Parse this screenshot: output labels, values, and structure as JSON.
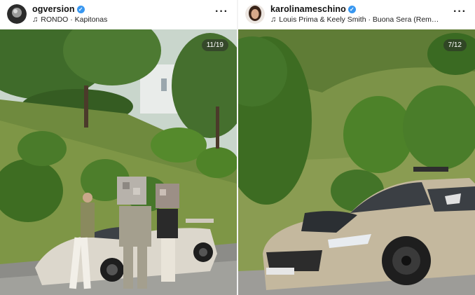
{
  "posts": [
    {
      "username": "ogversion",
      "music": "RONDO · Kapitonas",
      "counter": "11/19"
    },
    {
      "username": "karolinameschino",
      "music": "Louis Prima & Keely Smith · Buona Sera (Rem…",
      "counter": "7/12"
    }
  ],
  "icons": {
    "verified": "verified-badge-icon",
    "music": "music-note-icon",
    "more": "more-options-icon"
  },
  "colors": {
    "verified": "#3897f0",
    "car_left": "#dcd7cc",
    "car_right": "#c4b89e"
  }
}
